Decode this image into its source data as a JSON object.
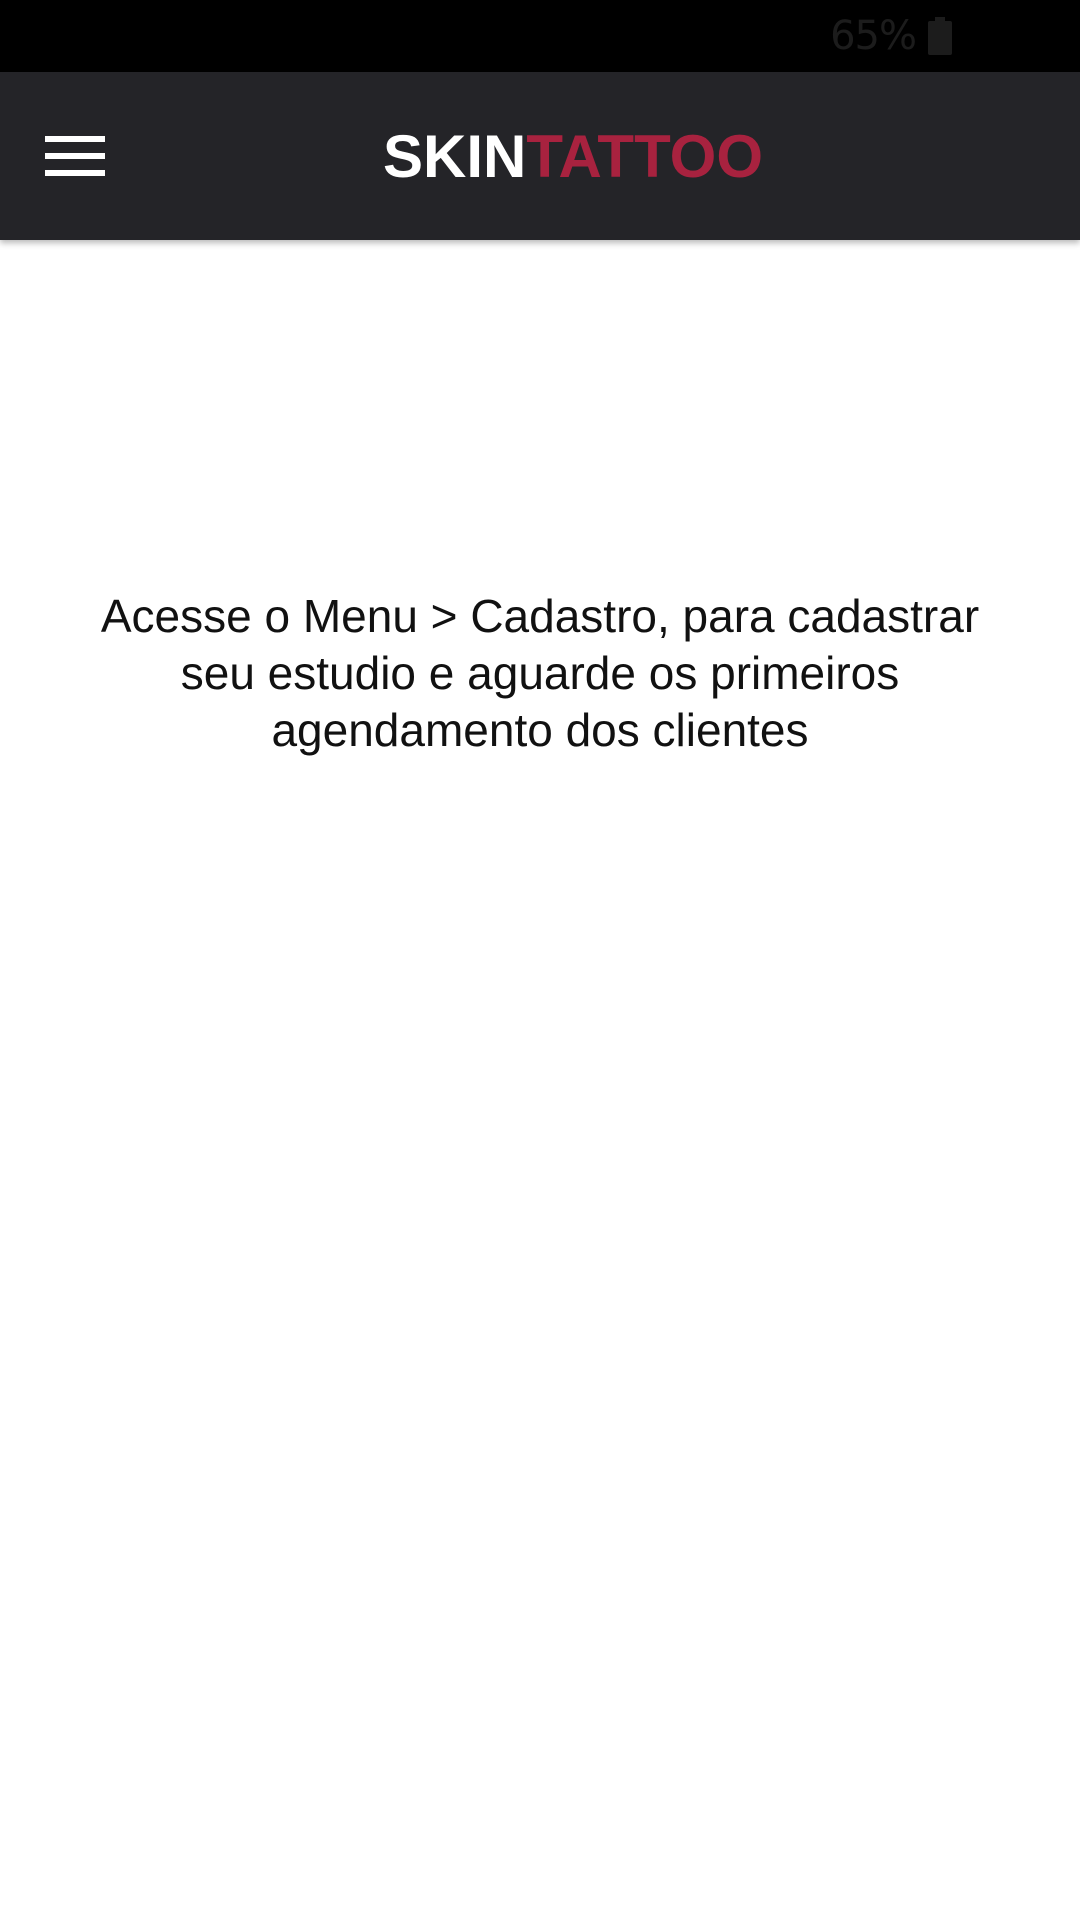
{
  "status_bar": {
    "battery_percent": "65%",
    "battery_icon": "battery-icon"
  },
  "app_bar": {
    "menu_icon": "hamburger-menu-icon",
    "logo": {
      "part1": "SKIN",
      "part2": "TATTOO",
      "part1_color": "#ffffff",
      "part2_color": "#a8223f"
    },
    "background_color": "#242428"
  },
  "main": {
    "message": "Acesse o Menu > Cadastro, para cadastrar seu estudio e aguarde os primeiros agendamento dos clientes"
  }
}
